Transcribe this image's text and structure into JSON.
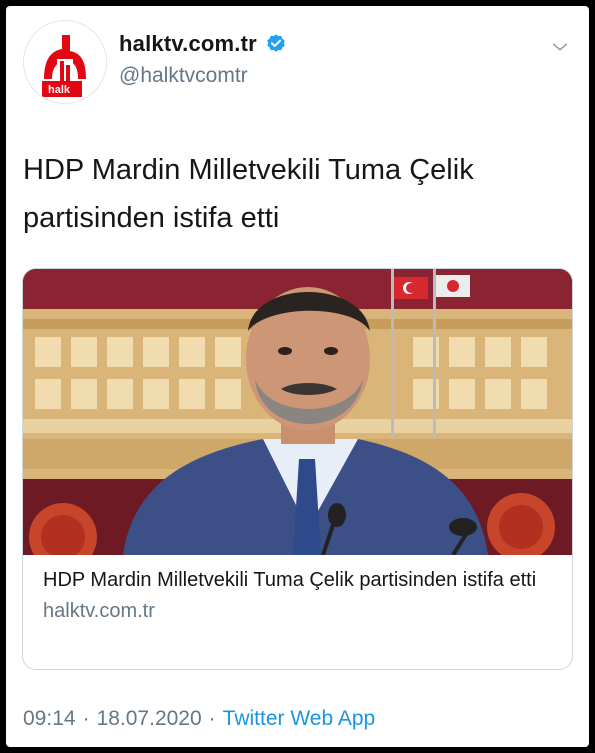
{
  "tweet": {
    "author": {
      "display_name": "halktv.com.tr",
      "handle": "@halktvcomtr",
      "verified": true,
      "avatar_text": "halk",
      "avatar_icon": "halktv-logo-icon"
    },
    "text": "HDP Mardin Milletvekili Tuma Çelik partisinden istifa etti",
    "card": {
      "title": "HDP Mardin Milletvekili Tuma Çelik partisinden istifa etti",
      "domain": "halktv.com.tr",
      "image_icon": "news-photo-image"
    },
    "time": "09:14",
    "date": "18.07.2020",
    "separator": "·",
    "source_app": "Twitter Web App",
    "menu_icon": "chevron-down-icon"
  },
  "colors": {
    "text_primary": "#14171a",
    "text_secondary": "#657786",
    "link": "#1b95e0",
    "verified": "#1da1f2",
    "brand_red": "#e30613",
    "border": "#ccd6dd"
  }
}
